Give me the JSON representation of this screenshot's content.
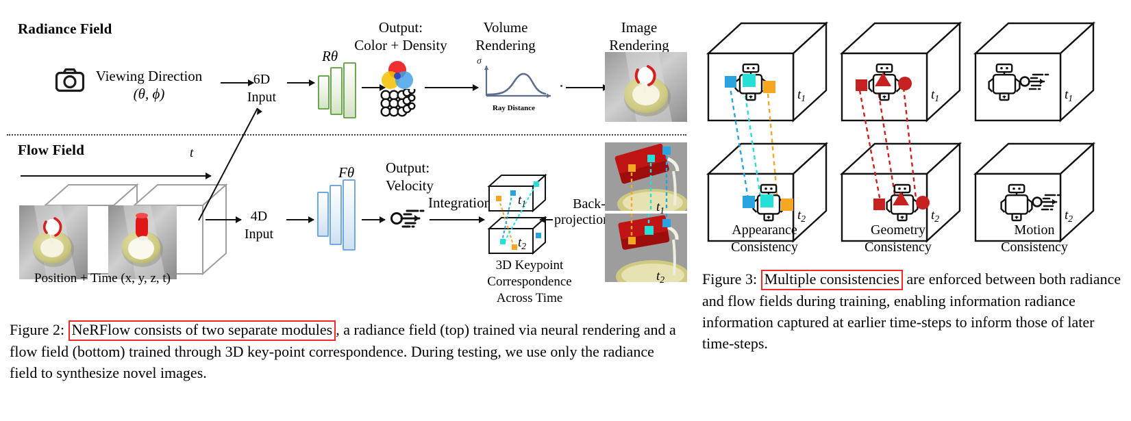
{
  "figure2": {
    "radiance": {
      "title": "Radiance Field",
      "camera_icon": "camera-icon",
      "viewing_direction_label": "Viewing Direction",
      "viewing_direction_params": "(θ, ϕ)",
      "input_label_line1": "6D",
      "input_label_line2": "Input",
      "network_label": "Rθ",
      "output_line1": "Output:",
      "output_line2": "Color + Density",
      "color_icon": "rgb-venn-icon",
      "density_icon": "voxel-grid-icon",
      "volume_line1": "Volume",
      "volume_line2": "Rendering",
      "plot_y_axis": "σ",
      "plot_x_axis": "Ray Distance",
      "image_line1": "Image",
      "image_line2": "Rendering"
    },
    "flow": {
      "title": "Flow Field",
      "time_axis_label": "t",
      "position_time_label": "Position + Time (x, y, z, t)",
      "input_label_line1": "4D",
      "input_label_line2": "Input",
      "network_label": "Fθ",
      "output_line1": "Output:",
      "output_line2": "Velocity",
      "velocity_icon": "speed-lines-icon",
      "integration_label": "Integration",
      "cube_t1": "t",
      "cube_t1_sub": "1",
      "cube_t2": "t",
      "cube_t2_sub": "2",
      "keypoint_line1": "3D Keypoint",
      "keypoint_line2": "Correspondence",
      "keypoint_line3": "Across Time",
      "backprojection_line1": "Back-",
      "backprojection_line2": "projection",
      "render_t1": "t",
      "render_t1_sub": "1",
      "render_t2": "t",
      "render_t2_sub": "2"
    },
    "caption": {
      "prefix": "Figure 2:",
      "highlight": "NeRFlow consists of two separate modules",
      "rest": ", a radiance field (top) trained via neural rendering and a flow field (bottom) trained through 3D key-point correspondence. During testing, we use only the radiance field to synthesize novel images."
    }
  },
  "figure3": {
    "panels": [
      {
        "label_line1": "Appearance",
        "label_line2": "Consistency",
        "top_time": "t",
        "top_time_sub": "1",
        "bottom_time": "t",
        "bottom_time_sub": "2",
        "robot_icon": "robot-icon",
        "marker_colors": [
          "#29a3dd",
          "#25e0d8",
          "#f5a623"
        ]
      },
      {
        "label_line1": "Geometry",
        "label_line2": "Consistency",
        "top_time": "t",
        "top_time_sub": "1",
        "bottom_time": "t",
        "bottom_time_sub": "2",
        "robot_icon": "robot-icon",
        "marker_colors": [
          "#c62020",
          "#c62020",
          "#c62020"
        ]
      },
      {
        "label_line1": "Motion",
        "label_line2": "Consistency",
        "top_time": "t",
        "top_time_sub": "1",
        "bottom_time": "t",
        "bottom_time_sub": "2",
        "robot_icon": "robot-motion-icon",
        "marker_colors": []
      }
    ],
    "caption": {
      "prefix": "Figure 3:",
      "highlight": "Multiple consistencies",
      "rest": " are enforced between both radiance and flow fields during training, enabling information radiance information captured at earlier time-steps to inform those of later time-steps."
    }
  },
  "colors": {
    "highlight_border": "#ee2a2a",
    "mlp_green": "#6aa84f",
    "mlp_blue": "#6fa8dc",
    "marker_blue": "#29a3dd",
    "marker_cyan": "#25e0d8",
    "marker_orange": "#f5a623",
    "marker_red": "#c62020",
    "plot_line": "#5b6e8c"
  }
}
